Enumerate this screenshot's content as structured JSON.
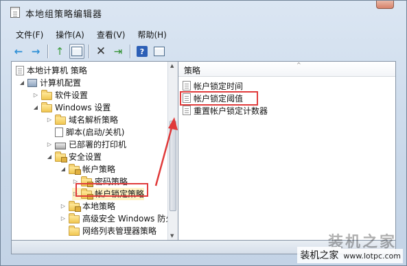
{
  "window": {
    "title": "本地组策略编辑器",
    "title_icon": "policy-editor-icon"
  },
  "menu": [
    {
      "label": "文件(F)"
    },
    {
      "label": "操作(A)"
    },
    {
      "label": "查看(V)"
    },
    {
      "label": "帮助(H)"
    }
  ],
  "toolbar": {
    "back": "←",
    "forward": "→",
    "up": "↑",
    "delete": "✕",
    "export": "⇥",
    "help": "?"
  },
  "tree": {
    "items": [
      {
        "label": "本地计算机 策略",
        "icon": "policy-doc-icon"
      },
      {
        "label": "计算机配置",
        "icon": "computer-icon",
        "twist": "◢"
      },
      {
        "label": "软件设置",
        "icon": "folder-icon",
        "twist": "▷"
      },
      {
        "label": "Windows 设置",
        "icon": "folder-icon",
        "twist": "◢"
      },
      {
        "label": "域名解析策略",
        "icon": "folder-icon",
        "twist": "▷"
      },
      {
        "label": "脚本(启动/关机)",
        "icon": "script-icon",
        "twist": ""
      },
      {
        "label": "已部署的打印机",
        "icon": "printer-icon",
        "twist": "▷"
      },
      {
        "label": "安全设置",
        "icon": "security-folder-icon",
        "twist": "◢"
      },
      {
        "label": "帐户策略",
        "icon": "lock-folder-icon",
        "twist": "◢"
      },
      {
        "label": "密码策略",
        "icon": "lock-folder-icon",
        "twist": "▷"
      },
      {
        "label": "帐户锁定策略",
        "icon": "lock-folder-icon",
        "twist": "▷"
      },
      {
        "label": "本地策略",
        "icon": "lock-folder-icon",
        "twist": "▷"
      },
      {
        "label": "高级安全 Windows 防火",
        "icon": "folder-icon",
        "twist": "▷"
      },
      {
        "label": "网络列表管理器策略",
        "icon": "folder-icon",
        "twist": ""
      }
    ]
  },
  "list": {
    "header": "策略",
    "items": [
      {
        "label": "帐户锁定时间"
      },
      {
        "label": "帐户锁定阈值"
      },
      {
        "label": "重置帐户锁定计数器"
      }
    ]
  },
  "watermark": {
    "main": "装机之家",
    "url": "www.lotpc.com",
    "big": "装机之家"
  },
  "colors": {
    "highlight": "#e03a3a",
    "window_bg": "#c9d8e9"
  }
}
